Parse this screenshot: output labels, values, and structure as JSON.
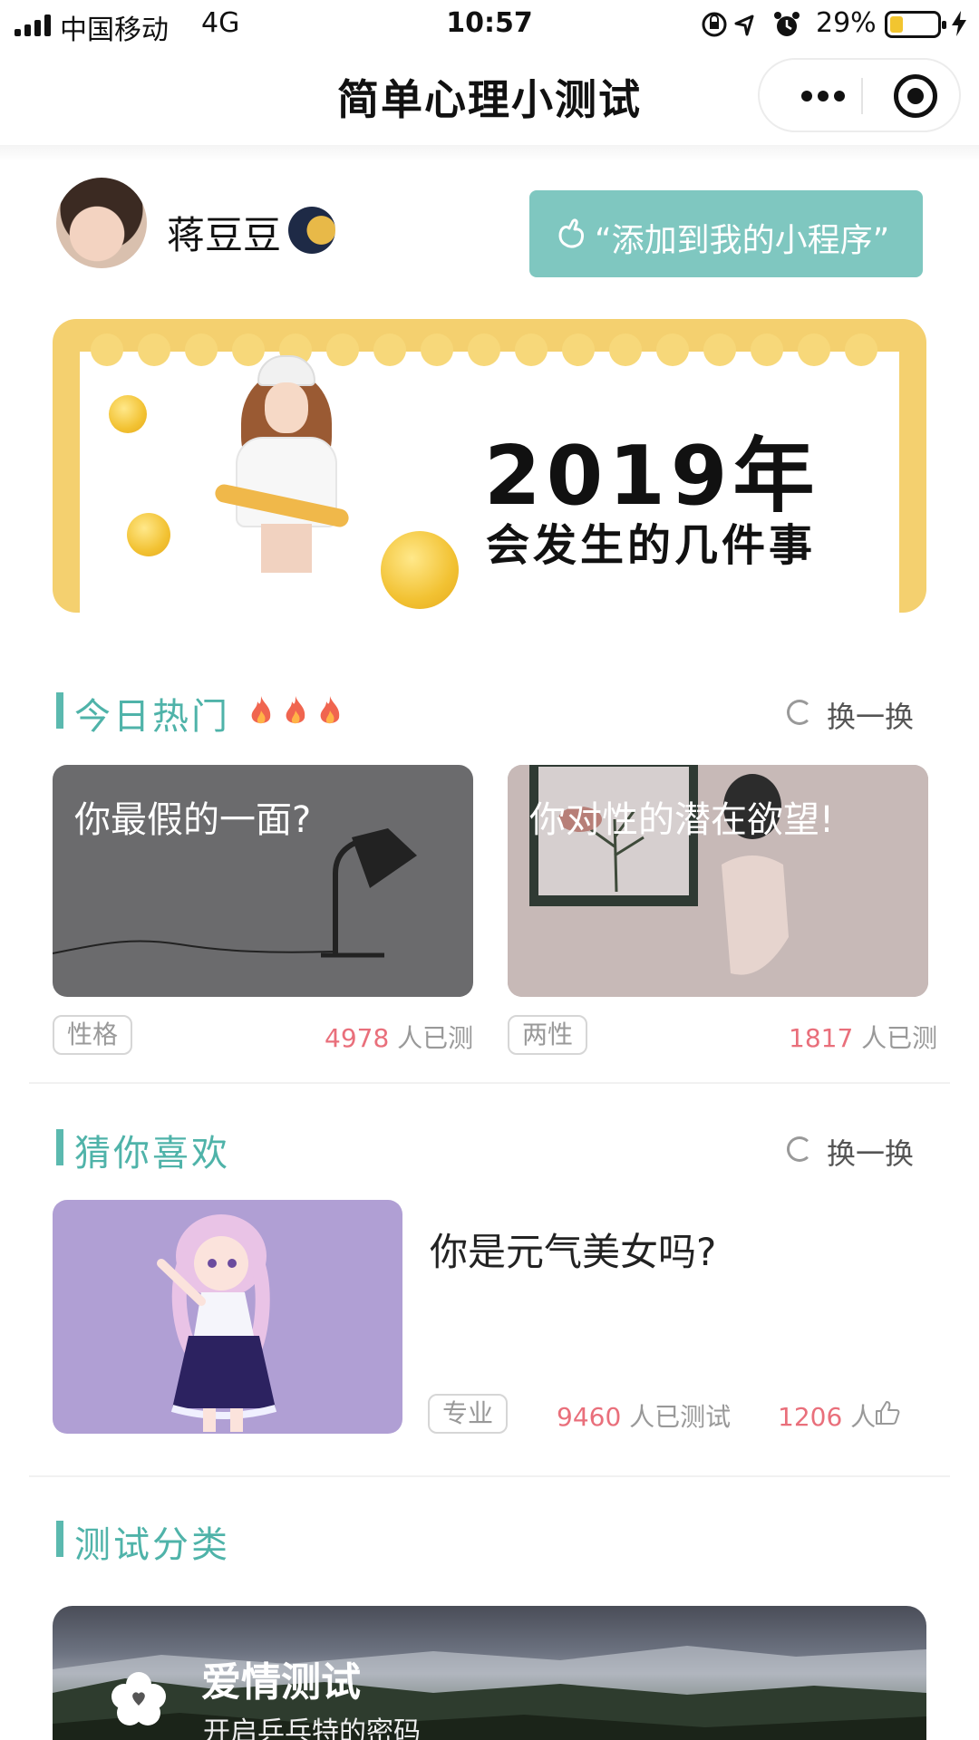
{
  "status_bar": {
    "carrier": "中国移动",
    "network": "4G",
    "time": "10:57",
    "battery_percent": "29%",
    "battery_level": 0.29,
    "icons": [
      "signal-icon",
      "orientation-lock-icon",
      "location-icon",
      "alarm-icon",
      "battery-icon",
      "charging-icon"
    ]
  },
  "nav": {
    "title": "简单心理小测试",
    "icons": [
      "more-icon",
      "close-target-icon"
    ]
  },
  "user": {
    "name": "蒋豆豆",
    "add_button_label": "“添加到我的小程序”"
  },
  "banner": {
    "year_text": "2019年",
    "sub_text": "会发生的几件事"
  },
  "hot": {
    "title": "今日热门",
    "refresh_label": "换一换",
    "cards": [
      {
        "title": "你最假的一面?",
        "tag": "性格",
        "count": "4978",
        "count_suffix": "人已测"
      },
      {
        "title": "你对性的潜在欲望!",
        "tag": "两性",
        "count": "1817",
        "count_suffix": "人已测"
      }
    ]
  },
  "recommend": {
    "title": "猜你喜欢",
    "refresh_label": "换一换",
    "item": {
      "title": "你是元气美女吗?",
      "tag": "专业",
      "tested_count": "9460",
      "tested_suffix": "人已测试",
      "like_count": "1206",
      "like_suffix": "人"
    }
  },
  "categories": {
    "title": "测试分类",
    "items": [
      {
        "title": "爱情测试",
        "subtitle": "开启乒乓特的密码"
      }
    ]
  },
  "colors": {
    "accent": "#5bb9af",
    "button": "#7fc7c0",
    "count": "#e96f7b",
    "banner_frame": "#f4d06f"
  }
}
